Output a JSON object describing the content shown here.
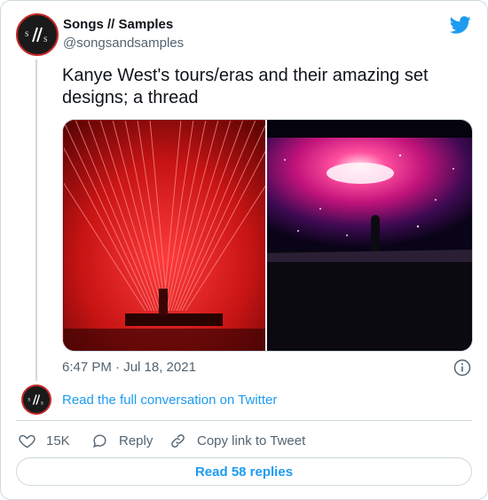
{
  "author": {
    "name": "Songs // Samples",
    "handle": "@songsandsamples"
  },
  "tweet": {
    "text": "Kanye West's tours/eras and their amazing set designs; a thread",
    "timestamp": "6:47 PM · Jul 18, 2021"
  },
  "media": [
    {
      "icon": "red-laser-stage-photo"
    },
    {
      "icon": "galaxy-stage-silhouette-photo"
    }
  ],
  "conversation": {
    "link_label": "Read the full conversation on Twitter"
  },
  "actions": {
    "likes_count": "15K",
    "reply_label": "Reply",
    "copy_label": "Copy link to Tweet"
  },
  "footer": {
    "read_replies_label": "Read 58 replies"
  },
  "colors": {
    "accent": "#1d9bf0",
    "text_secondary": "#536471",
    "border": "#cfd9de",
    "avatar_ring": "#c62828"
  }
}
